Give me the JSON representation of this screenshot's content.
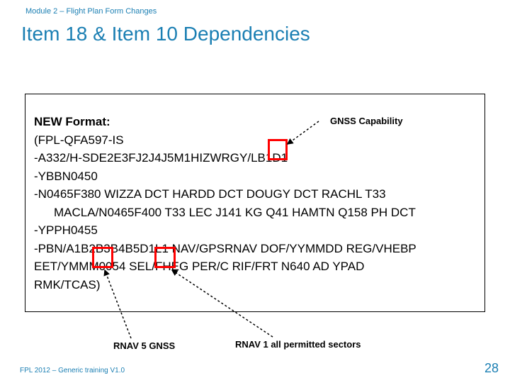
{
  "module": "Module 2 – Flight Plan Form Changes",
  "title": "Item 18 & Item 10 Dependencies",
  "box": {
    "heading": "NEW Format:",
    "l1": "(FPL-QFA597-IS",
    "l2": "-A332/H-SDE2E3FJ2J4J5M1HIZWRGY/LB1D1",
    "l3": "-YBBN0450",
    "l4a": "-N0465F380 WIZZA DCT HARDD DCT DOUGY DCT RACHL T33",
    "l4b": "MACLA/N0465F400 T33 LEC J141 KG Q41 HAMTN Q158 PH DCT",
    "l5": "-YPPH0455",
    "l6a": "-PBN/A1B2B3B4B5D1L1 NAV/GPSRNAV DOF/YYMMDD REG/VHEBP",
    "l6b": "EET/YMMM0054 SEL/FHEG PER/C RIF/FRT N640 AD YPAD",
    "l6c": "RMK/TCAS)"
  },
  "labels": {
    "gnss": "GNSS Capability",
    "rnav5": "RNAV 5 GNSS",
    "rnav1": "RNAV 1 all permitted sectors"
  },
  "footer": "FPL 2012 – Generic training V1.0",
  "page": "28"
}
